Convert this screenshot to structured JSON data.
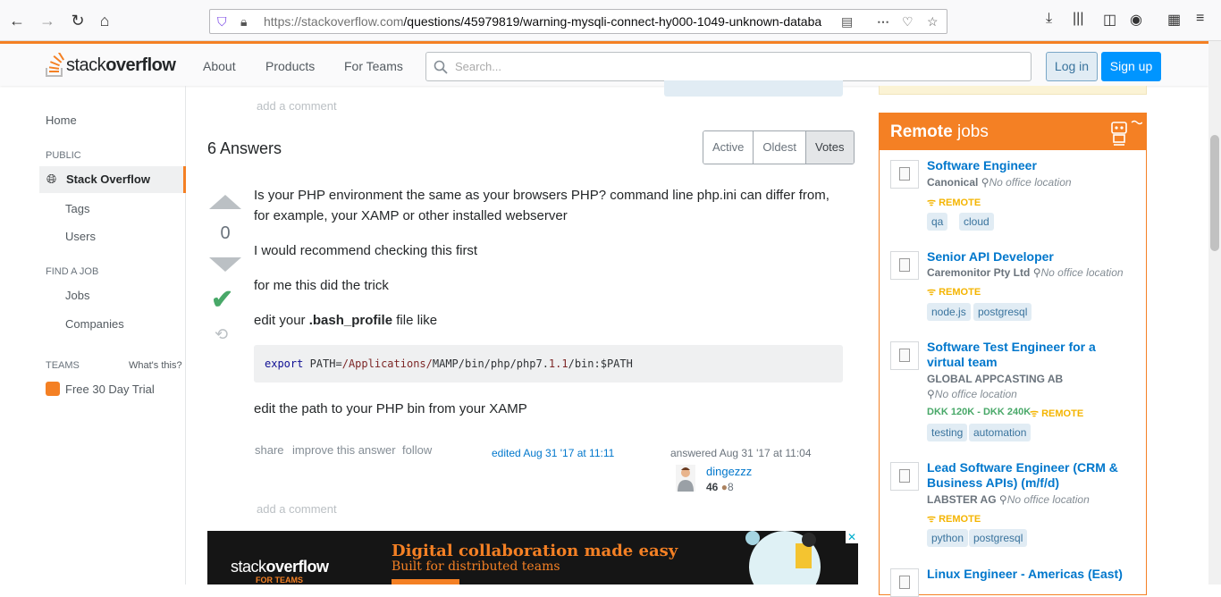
{
  "browser": {
    "url_host": "https://stackoverflow.com",
    "url_path": "/questions/45979819/warning-mysqli-connect-hy000-1049-unknown-databa"
  },
  "header": {
    "logo_text_light": "stack",
    "logo_text_bold": "overflow",
    "nav": [
      "About",
      "Products",
      "For Teams"
    ],
    "search_placeholder": "Search...",
    "login_label": "Log in",
    "signup_label": "Sign up"
  },
  "sidebar": {
    "home": "Home",
    "public_head": "PUBLIC",
    "stack_overflow": "Stack Overflow",
    "tags": "Tags",
    "users": "Users",
    "find_job_head": "FIND A JOB",
    "jobs": "Jobs",
    "companies": "Companies",
    "teams_head": "TEAMS",
    "whats_this": "What's this?",
    "free_trial": "Free 30 Day Trial"
  },
  "main": {
    "add_comment_top": "add a comment",
    "answers_title": "6 Answers",
    "sort_tabs": [
      "Active",
      "Oldest",
      "Votes"
    ],
    "vote_count": "0",
    "paragraphs": [
      "Is your PHP environment the same as your browsers PHP? command line php.ini can differ from, for example, your XAMP or other installed webserver",
      "I would recommend checking this first",
      "for me this did the trick"
    ],
    "edit_prefix": "edit your ",
    "edit_bold": ".bash_profile",
    "edit_suffix": " file like",
    "code": {
      "kw": "export",
      "plain1": " PATH=",
      "str": "/Applications/",
      "plain2": "MAMP/bin/php/php7.",
      "num": "1.1",
      "plain3": "/bin:$PATH"
    },
    "after_code": "edit the path to your PHP bin from your XAMP",
    "menu": [
      "share",
      "improve this answer",
      "follow"
    ],
    "edited": "edited Aug 31 '17 at 11:11",
    "answered": "answered Aug 31 '17 at 11:04",
    "user_name": "dingezzz",
    "user_rep": "46",
    "user_bronze": "8",
    "add_comment_bottom": "add a comment",
    "ad": {
      "logo_light": "stack",
      "logo_bold": "overflow",
      "logo_sub": "FOR TEAMS",
      "title": "Digital collaboration made easy",
      "subtitle": "Built for distributed teams"
    }
  },
  "jobs": {
    "title_bold": "Remote",
    "title_rest": " jobs",
    "items": [
      {
        "title": "Software Engineer",
        "company": "Canonical",
        "location": "No office location",
        "salary": "",
        "remote": "REMOTE",
        "tags": [
          "qa",
          "cloud"
        ]
      },
      {
        "title": "Senior API Developer",
        "company": "Caremonitor Pty Ltd",
        "location": "No office location",
        "salary": "",
        "remote": "REMOTE",
        "tags": [
          "node.js",
          "postgresql"
        ]
      },
      {
        "title": "Software Test Engineer for a virtual team",
        "company": "GLOBAL APPCASTING AB",
        "location": "No office location",
        "salary": "DKK 120K - DKK 240K",
        "remote": "REMOTE",
        "tags": [
          "testing",
          "automation"
        ]
      },
      {
        "title": "Lead Software Engineer (CRM & Business APIs) (m/f/d)",
        "company": "LABSTER AG",
        "location": "No office location",
        "salary": "",
        "remote": "REMOTE",
        "tags": [
          "python",
          "postgresql"
        ]
      },
      {
        "title": "Linux Engineer - Americas (East)",
        "company": "",
        "location": "",
        "salary": "",
        "remote": "",
        "tags": []
      }
    ]
  },
  "colors": {
    "accent": "#f48024",
    "link": "#0077cc",
    "accepted": "#48a868",
    "remote": "#f4b400"
  }
}
